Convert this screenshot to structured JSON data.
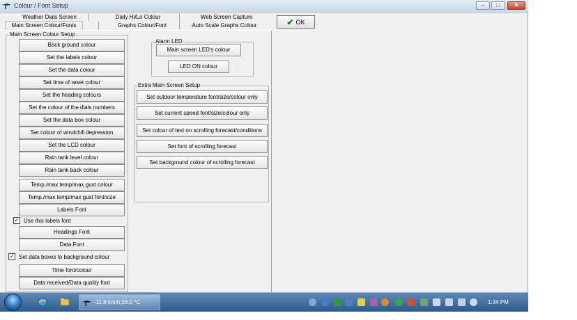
{
  "window": {
    "title": "Colour / Font Setup"
  },
  "titlebar_buttons": {
    "minimize": "–",
    "maximize": "□",
    "close": "✕"
  },
  "tabs": {
    "row1": [
      "Weather Dials Screen",
      "Daily Hi/Lo Colour",
      "Web Screen Capture"
    ],
    "row2": [
      "Main Screen Colour/Fonts",
      "Graphs Colour/Font",
      "Auto Scale Graphs Colour"
    ]
  },
  "ok_button": {
    "label": "OK"
  },
  "main_group": {
    "label": "Main Screen Colour Setup",
    "buttons": [
      "Back ground colour",
      "Set the labels colour",
      "Set the data colour",
      "Set time of reset colour",
      "Set the heading colours",
      "Set the colour of the dials numbers",
      "Set the data box colour",
      "Set colour of windchill depression",
      "Set the LCD  colour",
      "Rain tank level colour",
      "Rain tank back colour",
      "Temp./max temp/max gust colour",
      "Temp./max temp/max gust font/size",
      "Labels Font",
      "Headings Font",
      "Data Font",
      "Time font/colour",
      "Data received/Data quality font"
    ],
    "checkbox_labels_font": "Use this labels font",
    "checkbox_data_boxes": "Set data boxes to background colour"
  },
  "alarm_group": {
    "label": "Alarm LED",
    "buttons": [
      "Main screen LED's colour",
      "LED ON colour"
    ]
  },
  "extra_group": {
    "label": "Extra Main Screen Setup",
    "buttons": [
      "Set outdoor temperature font/size/colour only",
      "Set current speed font/size/colour only",
      "Set colour of text on scrolling forecast/conditions",
      "Set font of scrolling forecast",
      "Set background colour of scrolling forecast"
    ]
  },
  "taskbar": {
    "task_label": "-11.8 km/h,28.0 °C",
    "clock": "1:34 PM"
  }
}
